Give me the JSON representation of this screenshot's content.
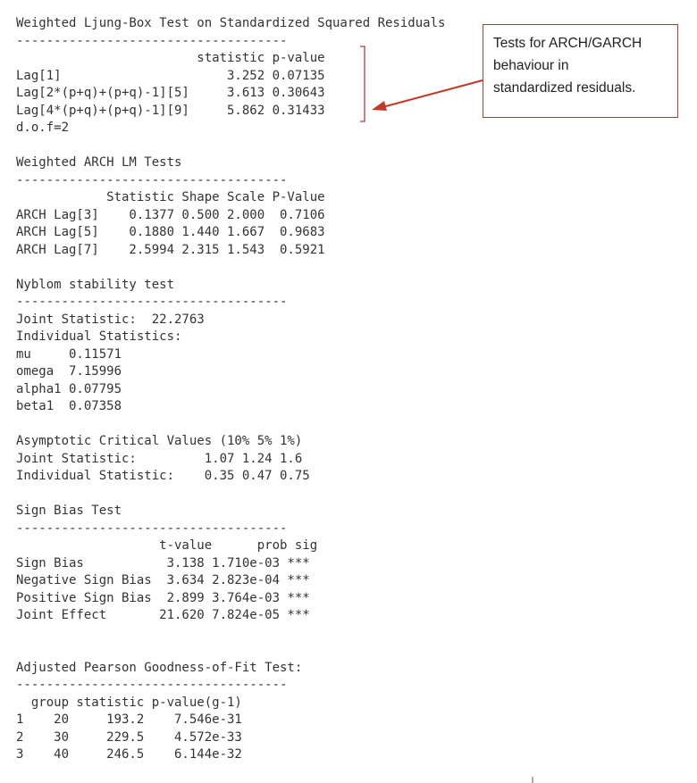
{
  "console_lines": [
    "Weighted Ljung-Box Test on Standardized Squared Residuals",
    "------------------------------------",
    "                        statistic p-value",
    "Lag[1]                      3.252 0.07135",
    "Lag[2*(p+q)+(p+q)-1][5]     3.613 0.30643",
    "Lag[4*(p+q)+(p+q)-1][9]     5.862 0.31433",
    "d.o.f=2",
    "",
    "Weighted ARCH LM Tests",
    "------------------------------------",
    "            Statistic Shape Scale P-Value",
    "ARCH Lag[3]    0.1377 0.500 2.000  0.7106",
    "ARCH Lag[5]    0.1880 1.440 1.667  0.9683",
    "ARCH Lag[7]    2.5994 2.315 1.543  0.5921",
    "",
    "Nyblom stability test",
    "------------------------------------",
    "Joint Statistic:  22.2763",
    "Individual Statistics:",
    "mu     0.11571",
    "omega  7.15996",
    "alpha1 0.07795",
    "beta1  0.07358",
    "",
    "Asymptotic Critical Values (10% 5% 1%)",
    "Joint Statistic:         1.07 1.24 1.6",
    "Individual Statistic:    0.35 0.47 0.75",
    "",
    "Sign Bias Test",
    "------------------------------------",
    "                   t-value      prob sig",
    "Sign Bias           3.138 1.710e-03 ***",
    "Negative Sign Bias  3.634 2.823e-04 ***",
    "Positive Sign Bias  2.899 3.764e-03 ***",
    "Joint Effect       21.620 7.824e-05 ***",
    "",
    "",
    "Adjusted Pearson Goodness-of-Fit Test:",
    "------------------------------------",
    "  group statistic p-value(g-1)",
    "1    20     193.2    7.546e-31",
    "2    30     229.5    4.572e-33",
    "3    40     246.5    6.144e-32"
  ],
  "annotation": {
    "lines": [
      "Tests for ARCH/GARCH",
      "behaviour in",
      "standardized residuals."
    ],
    "border_color": "#b03a3a",
    "arrow_color": "#c0392b"
  }
}
